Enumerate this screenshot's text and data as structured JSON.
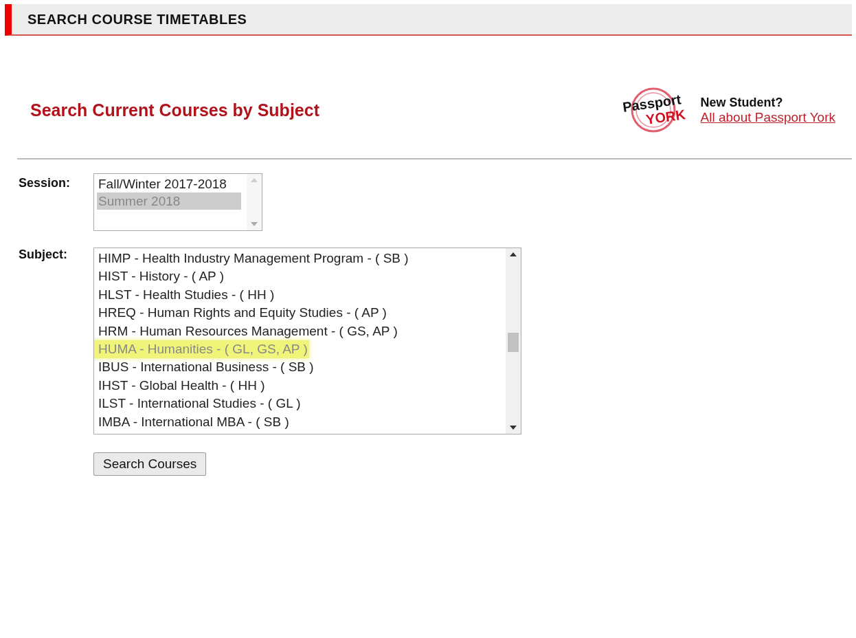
{
  "header": {
    "title": "SEARCH COURSE TIMETABLES"
  },
  "heading": "Search Current Courses by Subject",
  "promo": {
    "logo_top": "Passport",
    "logo_bottom": "YORK",
    "question": "New Student?",
    "link": "All about Passport York"
  },
  "session": {
    "label": "Session:",
    "options": [
      {
        "text": "Fall/Winter 2017-2018",
        "selected": false
      },
      {
        "text": "Summer 2018",
        "selected": true
      }
    ]
  },
  "subject": {
    "label": "Subject:",
    "options": [
      {
        "text": "HIMP - Health Industry Management Program - ( SB )",
        "highlighted": false
      },
      {
        "text": "HIST - History - ( AP )",
        "highlighted": false
      },
      {
        "text": "HLST - Health Studies - ( HH )",
        "highlighted": false
      },
      {
        "text": "HREQ - Human Rights and Equity Studies - ( AP )",
        "highlighted": false
      },
      {
        "text": "HRM - Human Resources Management - ( GS, AP )",
        "highlighted": false
      },
      {
        "text": "HUMA - Humanities - ( GL, GS, AP )",
        "highlighted": true
      },
      {
        "text": "IBUS - International Business - ( SB )",
        "highlighted": false
      },
      {
        "text": "IHST - Global Health - ( HH )",
        "highlighted": false
      },
      {
        "text": "ILST - International Studies - ( GL )",
        "highlighted": false
      },
      {
        "text": "IMBA - International MBA - ( SB )",
        "highlighted": false
      }
    ]
  },
  "button": "Search Courses"
}
